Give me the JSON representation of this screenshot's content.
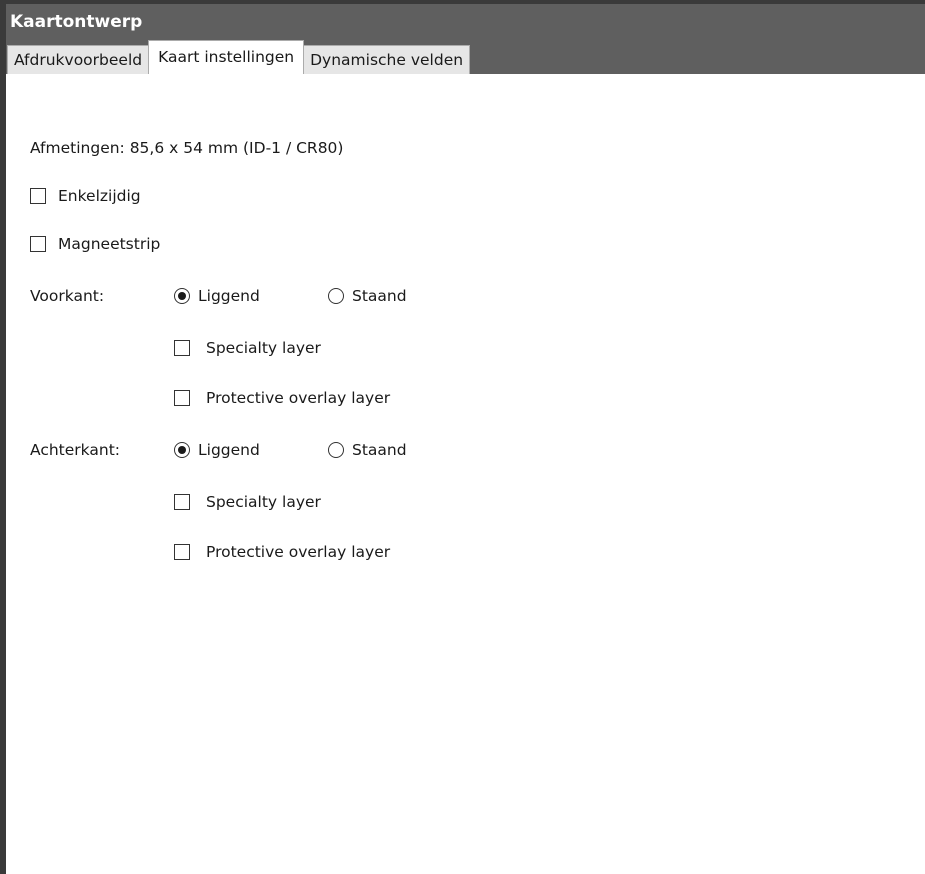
{
  "window": {
    "title": "Kaartontwerp"
  },
  "tabs": [
    {
      "label": "Afdrukvoorbeeld",
      "active": false
    },
    {
      "label": "Kaart instellingen",
      "active": true
    },
    {
      "label": "Dynamische velden",
      "active": false
    }
  ],
  "settings": {
    "dimensions_label": "Afmetingen: 85,6 x 54 mm (ID-1 / CR80)",
    "single_sided": {
      "label": "Enkelzijdig",
      "checked": false
    },
    "magnetic_strip": {
      "label": "Magneetstrip",
      "checked": false
    },
    "front": {
      "label": "Voorkant:",
      "orientation_landscape": {
        "label": "Liggend",
        "checked": true
      },
      "orientation_portrait": {
        "label": "Staand",
        "checked": false
      },
      "specialty_layer": {
        "label": "Specialty layer",
        "checked": false
      },
      "protective_overlay": {
        "label": "Protective overlay layer",
        "checked": false
      }
    },
    "back": {
      "label": "Achterkant:",
      "orientation_landscape": {
        "label": "Liggend",
        "checked": true
      },
      "orientation_portrait": {
        "label": "Staand",
        "checked": false
      },
      "specialty_layer": {
        "label": "Specialty layer",
        "checked": false
      },
      "protective_overlay": {
        "label": "Protective overlay layer",
        "checked": false
      }
    }
  },
  "colors": {
    "titlebar": "#5f5f5f",
    "tab_inactive": "#e6e6e6",
    "tab_active": "#ffffff"
  }
}
